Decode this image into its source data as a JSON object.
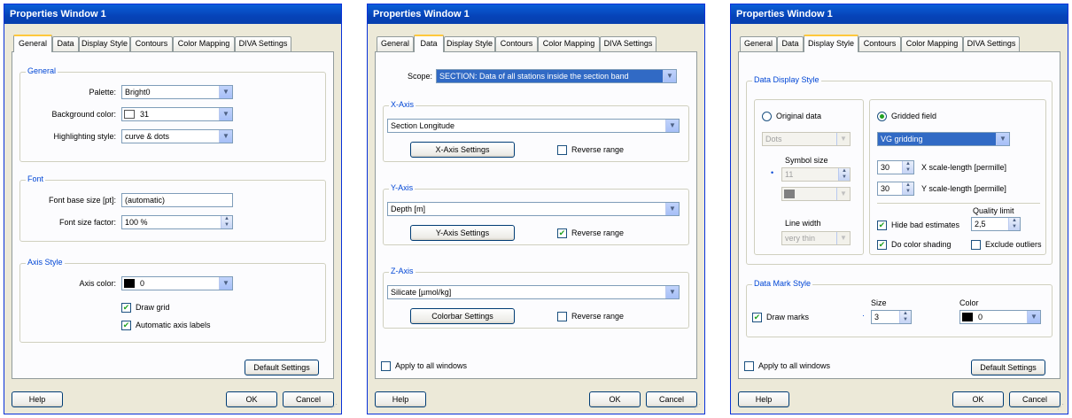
{
  "windows": [
    {
      "title": "Properties Window 1",
      "tabs": [
        "General",
        "Data",
        "Display Style",
        "Contours",
        "Color Mapping",
        "DIVA Settings"
      ],
      "general": {
        "title": "General",
        "palette_label": "Palette:",
        "palette_value": "Bright0",
        "bg_label": "Background color:",
        "bg_value": "31",
        "highlight_label": "Highlighting style:",
        "highlight_value": "curve & dots"
      },
      "font": {
        "title": "Font",
        "base_label": "Font base size [pt]:",
        "base_value": "(automatic)",
        "factor_label": "Font size factor:",
        "factor_value": "100 %"
      },
      "axis": {
        "title": "Axis Style",
        "color_label": "Axis color:",
        "color_value": "0",
        "grid_label": "Draw grid",
        "auto_label": "Automatic axis labels"
      },
      "default_btn": "Default Settings",
      "help": "Help",
      "ok": "OK",
      "cancel": "Cancel"
    },
    {
      "title": "Properties Window 1",
      "tabs": [
        "General",
        "Data",
        "Display Style",
        "Contours",
        "Color Mapping",
        "DIVA Settings"
      ],
      "scope_label": "Scope:",
      "scope_value": "SECTION: Data of all stations inside the section band",
      "xaxis": {
        "title": "X-Axis",
        "value": "Section Longitude",
        "settings": "X-Axis Settings",
        "reverse": "Reverse range"
      },
      "yaxis": {
        "title": "Y-Axis",
        "value": "Depth [m]",
        "settings": "Y-Axis Settings",
        "reverse": "Reverse range"
      },
      "zaxis": {
        "title": "Z-Axis",
        "value": "Silicate [µmol/kg]",
        "settings": "Colorbar Settings",
        "reverse": "Reverse range"
      },
      "apply_all": "Apply to all windows",
      "help": "Help",
      "ok": "OK",
      "cancel": "Cancel"
    },
    {
      "title": "Properties Window 1",
      "tabs": [
        "General",
        "Data",
        "Display Style",
        "Contours",
        "Color Mapping",
        "DIVA Settings"
      ],
      "dds": {
        "title": "Data Display Style",
        "original": "Original data",
        "dots": "Dots",
        "symbol_size_label": "Symbol size",
        "symbol_size_value": "11",
        "line_width_label": "Line width",
        "line_width_value": "very thin",
        "gridded": "Gridded field",
        "gridding_value": "VG gridding",
        "x_value": "30",
        "x_label": "X scale-length [permille]",
        "y_value": "30",
        "y_label": "Y scale-length [permille]",
        "quality_label": "Quality limit",
        "quality_value": "2,5",
        "hide_bad": "Hide bad estimates",
        "color_shading": "Do color shading",
        "exclude_outliers": "Exclude outliers"
      },
      "dms": {
        "title": "Data Mark Style",
        "draw_marks": "Draw marks",
        "size_label": "Size",
        "size_value": "3",
        "color_label": "Color",
        "color_value": "0"
      },
      "apply_all": "Apply to all windows",
      "default_btn": "Default Settings",
      "help": "Help",
      "ok": "OK",
      "cancel": "Cancel"
    }
  ]
}
